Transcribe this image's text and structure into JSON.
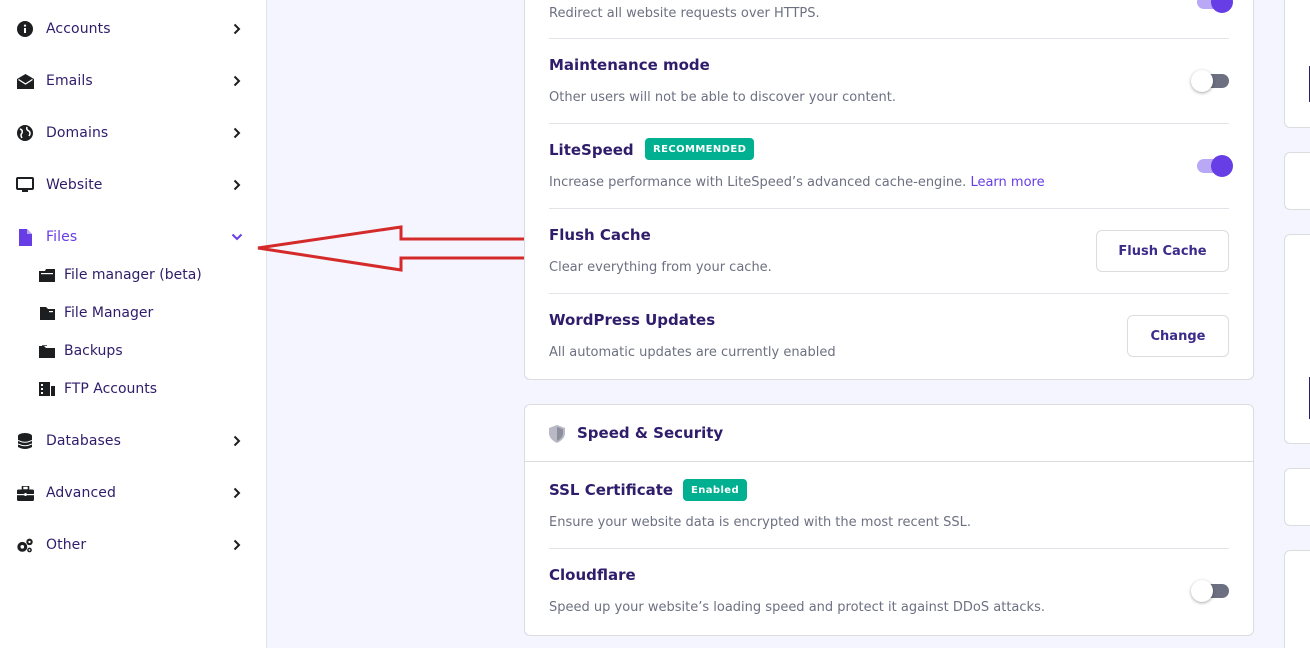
{
  "sidebar": {
    "items": [
      {
        "label": "Accounts",
        "icon": "info-icon"
      },
      {
        "label": "Emails",
        "icon": "envelope-icon"
      },
      {
        "label": "Domains",
        "icon": "globe-icon"
      },
      {
        "label": "Website",
        "icon": "monitor-icon"
      },
      {
        "label": "Files",
        "icon": "file-icon"
      },
      {
        "label": "Databases",
        "icon": "database-icon"
      },
      {
        "label": "Advanced",
        "icon": "toolbox-icon"
      },
      {
        "label": "Other",
        "icon": "gears-icon"
      }
    ],
    "files_subitems": [
      {
        "label": "File manager (beta)",
        "icon": "folder-open-icon"
      },
      {
        "label": "File Manager",
        "icon": "folder-icon"
      },
      {
        "label": "Backups",
        "icon": "backup-folder-icon"
      },
      {
        "label": "FTP Accounts",
        "icon": "ftp-icon"
      }
    ]
  },
  "settings": {
    "https_desc": "Redirect all website requests over HTTPS.",
    "maintenance": {
      "title": "Maintenance mode",
      "desc": "Other users will not be able to discover your content.",
      "enabled": false
    },
    "litespeed": {
      "title": "LiteSpeed",
      "badge": "RECOMMENDED",
      "desc": "Increase performance with LiteSpeed’s advanced cache-engine.",
      "link": "Learn more",
      "enabled": true
    },
    "flush_cache": {
      "title": "Flush Cache",
      "desc": "Clear everything from your cache.",
      "button": "Flush Cache"
    },
    "wp_updates": {
      "title": "WordPress Updates",
      "desc": "All automatic updates are currently enabled",
      "button": "Change"
    }
  },
  "speed_security": {
    "title": "Speed & Security",
    "ssl": {
      "title": "SSL Certificate",
      "badge": "Enabled",
      "desc": "Ensure your website data is encrypted with the most recent SSL."
    },
    "cloudflare": {
      "title": "Cloudflare",
      "desc": "Speed up your website’s loading speed and protect it against DDoS attacks.",
      "enabled": false
    }
  },
  "colors": {
    "accent": "#673de6",
    "text": "#2f1c6a",
    "badge": "#00b090",
    "annotation": "#d42a2a"
  }
}
